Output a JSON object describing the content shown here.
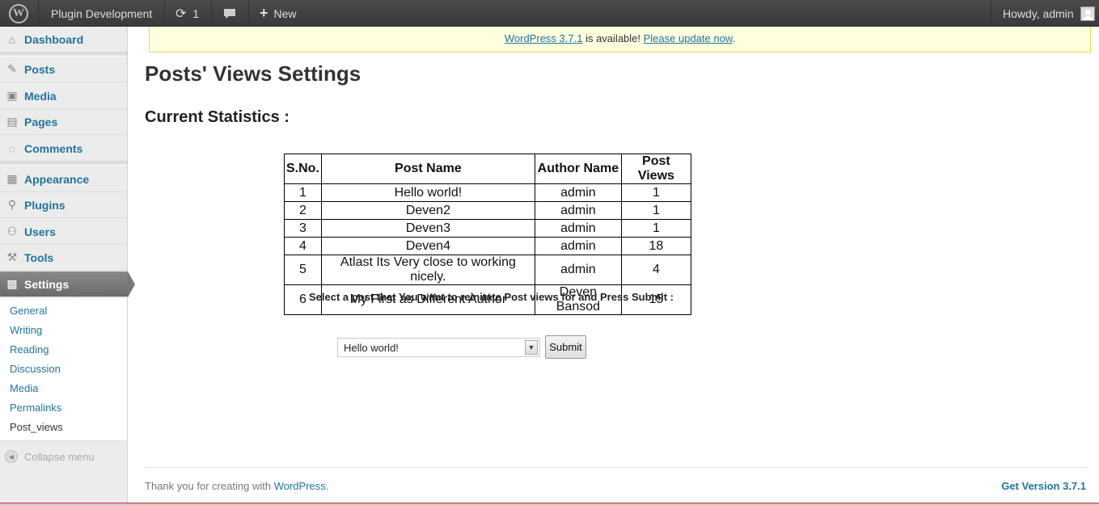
{
  "adminbar": {
    "site_name": "Plugin Development",
    "updates_count": "1",
    "new_label": "New",
    "howdy": "Howdy, admin"
  },
  "sidebar": {
    "items": [
      {
        "label": "Dashboard",
        "icon": "home-icon"
      },
      {
        "label": "Posts",
        "icon": "pin-icon"
      },
      {
        "label": "Media",
        "icon": "camera-icon"
      },
      {
        "label": "Pages",
        "icon": "pages-icon"
      },
      {
        "label": "Comments",
        "icon": "comment-icon"
      },
      {
        "label": "Appearance",
        "icon": "appearance-icon"
      },
      {
        "label": "Plugins",
        "icon": "plugin-icon"
      },
      {
        "label": "Users",
        "icon": "users-icon"
      },
      {
        "label": "Tools",
        "icon": "tools-icon"
      },
      {
        "label": "Settings",
        "icon": "settings-icon"
      }
    ],
    "submenu": [
      "General",
      "Writing",
      "Reading",
      "Discussion",
      "Media",
      "Permalinks",
      "Post_views"
    ],
    "collapse_label": "Collapse menu"
  },
  "notice": {
    "version_link": "WordPress 3.7.1",
    "middle_text": " is available! ",
    "update_link": "Please update now",
    "end": "."
  },
  "page": {
    "title": "Posts' Views Settings",
    "subtitle": "Current Statistics :",
    "table": {
      "headers": [
        "S.No.",
        "Post Name",
        "Author Name",
        "Post Views"
      ],
      "rows": [
        [
          "1",
          "Hello world!",
          "admin",
          "1"
        ],
        [
          "2",
          "Deven2",
          "admin",
          "1"
        ],
        [
          "3",
          "Deven3",
          "admin",
          "1"
        ],
        [
          "4",
          "Deven4",
          "admin",
          "18"
        ],
        [
          "5",
          "Atlast Its Very close to working nicely.",
          "admin",
          "4"
        ],
        [
          "6",
          "My First as Different Author",
          "Deven Bansod",
          "15"
        ]
      ]
    },
    "prompt": "Select a post that You want to reinitate Post views for and Press Submit :",
    "select_value": "Hello world!",
    "submit_label": "Submit"
  },
  "footer": {
    "thanks": "Thank you for creating with ",
    "wp_link": "WordPress",
    "end": ".",
    "version": "Get Version 3.7.1"
  },
  "colors": {
    "link": "#21759b",
    "notice_bg": "#ffffe0",
    "adminbar_bg": "#464646"
  }
}
